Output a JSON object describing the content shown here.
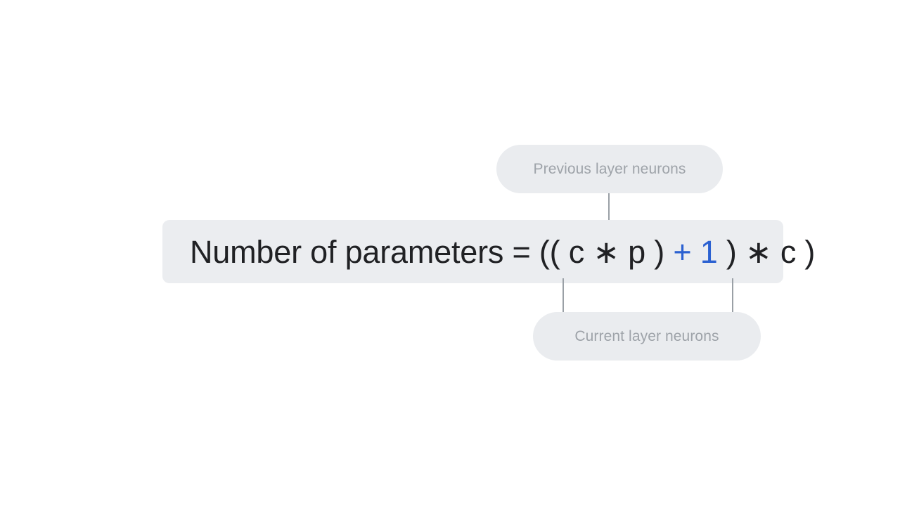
{
  "slide": {
    "background_color": "#ffffff"
  },
  "formula": {
    "bar_background": "#ebedf0",
    "text_color": "#202124",
    "accent_color": "#2b61d1",
    "full_text": "Number of parameters = (( c ∗ p ) + 1 ) ∗ c )",
    "tokens": [
      {
        "text": "Number of parameters = (( c ",
        "accent": false
      },
      {
        "text": "∗",
        "accent": false
      },
      {
        "text": " p ) ",
        "accent": false
      },
      {
        "text": "+ 1",
        "accent": true
      },
      {
        "text": " ) ",
        "accent": false
      },
      {
        "text": "∗",
        "accent": false
      },
      {
        "text": " c )",
        "accent": false
      }
    ],
    "segments": {
      "lead": "Number of parameters = (( c ",
      "asterisk_one": "∗",
      "previous_var": " p ) ",
      "bias": "+ 1",
      "close_paren": " ) ",
      "asterisk_two": "∗",
      "current_var": " c )"
    }
  },
  "callouts": {
    "pill_background": "#eaecef",
    "label_color": "#9ea3a9",
    "previous_layer": {
      "label": "Previous layer neurons",
      "points_to": "p"
    },
    "current_layer": {
      "label": "Current layer neurons",
      "points_to": "c"
    }
  },
  "connectors": {
    "color": "#9aa0a6",
    "items": [
      {
        "name": "previous-layer-to-p"
      },
      {
        "name": "current-layer-to-c-left"
      },
      {
        "name": "current-layer-to-c-right"
      }
    ]
  }
}
